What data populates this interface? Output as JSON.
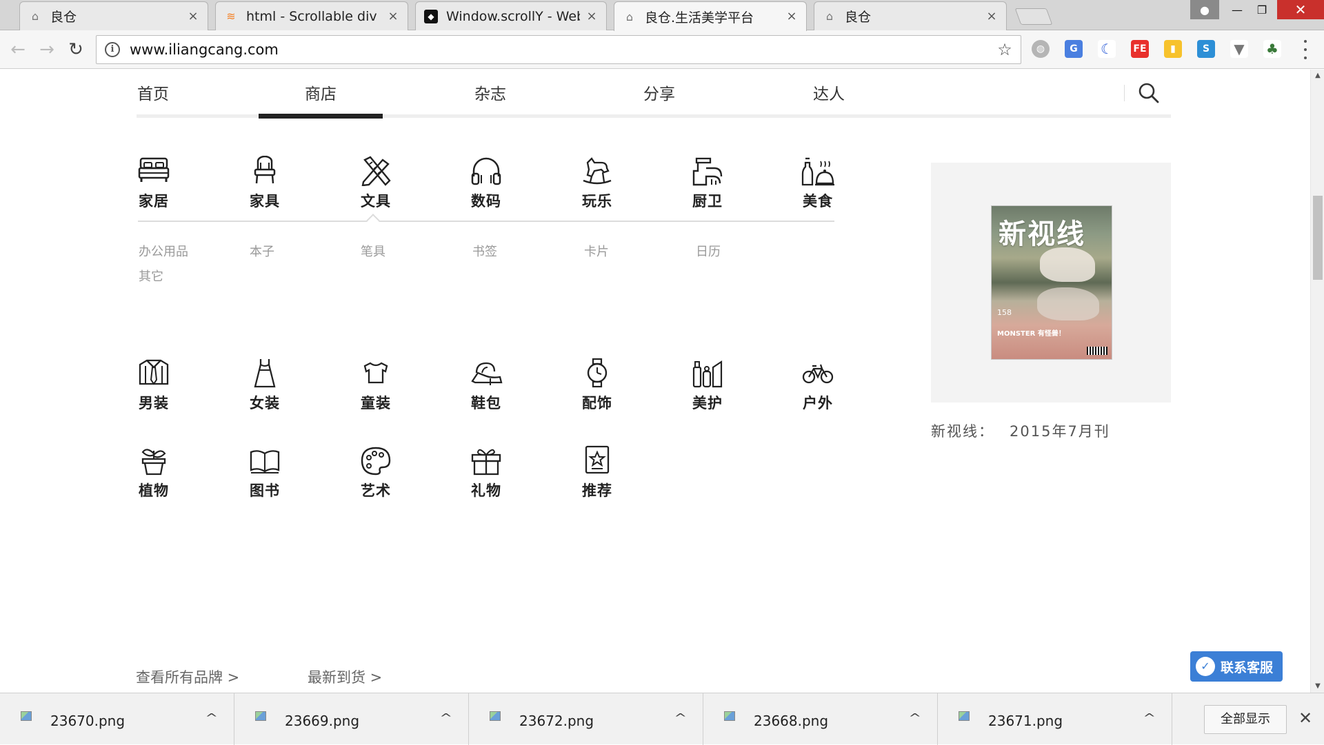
{
  "browser": {
    "tabs": [
      {
        "title": "良仓",
        "active": false
      },
      {
        "title": "html - Scrollable div : h",
        "active": false
      },
      {
        "title": "Window.scrollY - Web",
        "active": false
      },
      {
        "title": "良仓.生活美学平台",
        "active": true
      },
      {
        "title": "良仓",
        "active": false
      }
    ],
    "url": "www.iliangcang.com"
  },
  "nav": {
    "items": [
      "首页",
      "商店",
      "杂志",
      "分享",
      "达人"
    ],
    "active_index": 1
  },
  "categories_row1": [
    {
      "label": "家居",
      "icon": "bed-icon"
    },
    {
      "label": "家具",
      "icon": "chair-icon"
    },
    {
      "label": "文具",
      "icon": "pencil-ruler-icon"
    },
    {
      "label": "数码",
      "icon": "headphones-icon"
    },
    {
      "label": "玩乐",
      "icon": "rocking-horse-icon"
    },
    {
      "label": "厨卫",
      "icon": "faucet-icon"
    },
    {
      "label": "美食",
      "icon": "wine-dish-icon"
    }
  ],
  "subcategories": [
    "办公用品",
    "本子",
    "笔具",
    "书签",
    "卡片",
    "日历",
    "其它"
  ],
  "categories_row2": [
    {
      "label": "男装",
      "icon": "shirt-tie-icon"
    },
    {
      "label": "女装",
      "icon": "dress-icon"
    },
    {
      "label": "童装",
      "icon": "kids-shirt-icon"
    },
    {
      "label": "鞋包",
      "icon": "shoe-bag-icon"
    },
    {
      "label": "配饰",
      "icon": "watch-icon"
    },
    {
      "label": "美护",
      "icon": "cosmetics-icon"
    },
    {
      "label": "户外",
      "icon": "bicycle-icon"
    }
  ],
  "categories_row3": [
    {
      "label": "植物",
      "icon": "potted-plant-icon"
    },
    {
      "label": "图书",
      "icon": "open-book-icon"
    },
    {
      "label": "艺术",
      "icon": "palette-icon"
    },
    {
      "label": "礼物",
      "icon": "gift-icon"
    },
    {
      "label": "推荐",
      "icon": "star-badge-icon"
    }
  ],
  "promo": {
    "cover_title": "新视线",
    "cover_issue": "158",
    "cover_tagline": "MONSTER 有怪兽！",
    "caption": "新视线：",
    "date": "2015年7月刊"
  },
  "links": {
    "all_brands": "查看所有品牌 >",
    "new_arrivals": "最新到货 >"
  },
  "service_button": "联系客服",
  "downloads": {
    "files": [
      "23670.png",
      "23669.png",
      "23672.png",
      "23668.png",
      "23671.png"
    ],
    "show_all": "全部显示"
  },
  "colors": {
    "nav_active_bar": "#222222",
    "service_button": "#3b7fd6",
    "subcategory_text": "#999999"
  }
}
